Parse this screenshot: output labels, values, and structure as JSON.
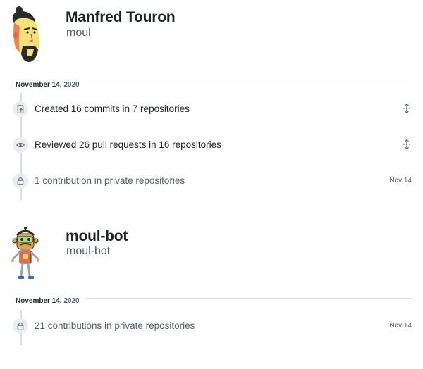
{
  "profiles": [
    {
      "name": "Manfred Touron",
      "login": "moul",
      "date": {
        "month_day": "November 14,",
        "year": "2020"
      },
      "items": [
        {
          "icon": "repo-push-icon",
          "text": "Created 16 commits in 7 repositories",
          "action": "unfold-icon"
        },
        {
          "icon": "eye-icon",
          "text": "Reviewed 26 pull requests in 16 repositories",
          "action": "unfold-icon"
        },
        {
          "icon": "lock-icon",
          "text": "1 contribution in private repositories",
          "date": "Nov 14"
        }
      ]
    },
    {
      "name": "moul-bot",
      "login": "moul-bot",
      "date": {
        "month_day": "November 14,",
        "year": "2020"
      },
      "items": [
        {
          "icon": "lock-icon",
          "text": "21 contributions in private repositories",
          "date": "Nov 14"
        }
      ]
    }
  ]
}
